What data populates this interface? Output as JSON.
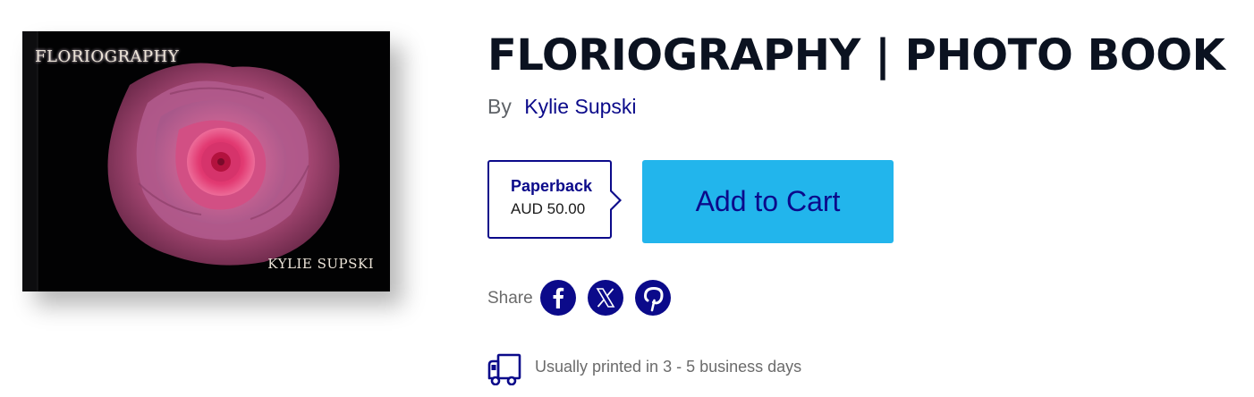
{
  "cover": {
    "title": "FLORIOGRAPHY",
    "author": "KYLIE SUPSKI"
  },
  "product": {
    "title": "FLORIOGRAPHY | PHOTO BOOK",
    "by_label": "By",
    "author": "Kylie Supski"
  },
  "format": {
    "name": "Paperback",
    "price": "AUD 50.00"
  },
  "cart": {
    "label": "Add to Cart"
  },
  "share": {
    "label": "Share",
    "icons": [
      "facebook-icon",
      "x-icon",
      "pinterest-icon"
    ]
  },
  "shipping": {
    "icon": "truck-icon",
    "text": "Usually printed in 3 - 5 business days"
  },
  "colors": {
    "brand_navy": "#0b0a8a",
    "cart_button": "#22b5ec",
    "title_text": "#0b1220",
    "muted_text": "#6b6b6b"
  }
}
